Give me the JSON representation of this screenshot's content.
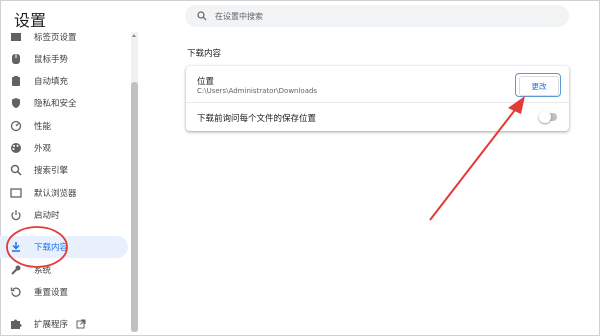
{
  "window_title": "设置",
  "search": {
    "placeholder": "在设置中搜索"
  },
  "sidebar": {
    "items": [
      {
        "label": "标签页设置",
        "icon": "tab-icon"
      },
      {
        "label": "鼠标手势",
        "icon": "mouse-icon"
      },
      {
        "label": "自动填充",
        "icon": "clipboard-icon"
      },
      {
        "label": "隐私和安全",
        "icon": "shield-icon"
      },
      {
        "label": "性能",
        "icon": "speedometer-icon"
      },
      {
        "label": "外观",
        "icon": "palette-icon"
      },
      {
        "label": "搜索引擎",
        "icon": "search-icon"
      },
      {
        "label": "默认浏览器",
        "icon": "browser-icon"
      },
      {
        "label": "启动时",
        "icon": "power-icon"
      },
      {
        "label": "下载内容",
        "icon": "download-icon",
        "active": true
      },
      {
        "label": "系统",
        "icon": "wrench-icon"
      },
      {
        "label": "重置设置",
        "icon": "reset-icon"
      },
      {
        "label": "扩展程序",
        "icon": "puzzle-icon",
        "external_icon": "external-link-icon"
      }
    ]
  },
  "main": {
    "section_title": "下载内容",
    "location": {
      "label": "位置",
      "path": "C:\\Users\\Administrator\\Downloads",
      "change_button": "更改"
    },
    "ask_where": {
      "label": "下载前询问每个文件的保存位置",
      "enabled": false
    }
  },
  "colors": {
    "accent": "#1a73e8",
    "active_bg": "#e8f0fe",
    "annotation_red": "#e53935",
    "highlight_blue": "#5b9bd5"
  }
}
